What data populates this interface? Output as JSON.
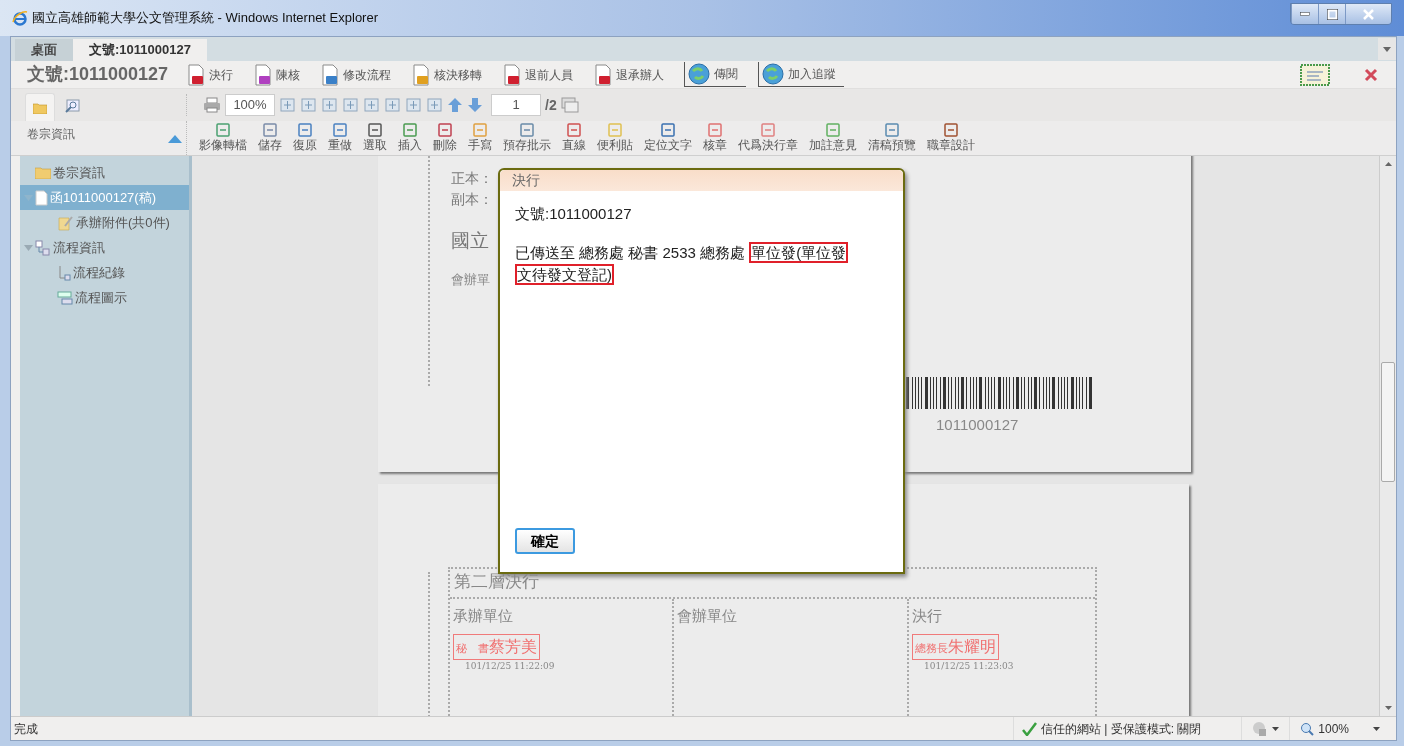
{
  "window": {
    "title": "國立高雄師範大學公文管理系統 - Windows Internet Explorer"
  },
  "tabs": [
    {
      "label": "桌面",
      "selected": false
    },
    {
      "label": "文號:1011000127",
      "selected": true
    }
  ],
  "action_bar": {
    "title": "文號:1011000127",
    "buttons": [
      {
        "label": "決行",
        "kind": "plain"
      },
      {
        "label": "陳核",
        "kind": "plain"
      },
      {
        "label": "修改流程",
        "kind": "plain"
      },
      {
        "label": "核決移轉",
        "kind": "plain"
      },
      {
        "label": "退前人員",
        "kind": "plain"
      },
      {
        "label": "退承辦人",
        "kind": "plain"
      },
      {
        "label": "傳閱",
        "kind": "globe"
      },
      {
        "label": "加入追蹤",
        "kind": "globe"
      }
    ]
  },
  "view_toolbar": {
    "zoom": "100%",
    "page": "1",
    "page_total": "/2"
  },
  "tool_panel": {
    "title": "卷宗資訊",
    "tools": [
      "影像轉檔",
      "儲存",
      "復原",
      "重做",
      "選取",
      "插入",
      "刪除",
      "手寫",
      "預存批示",
      "直線",
      "便利貼",
      "定位文字",
      "核章",
      "代爲決行章",
      "加註意見",
      "清稿預覽",
      "職章設計"
    ]
  },
  "sidebar": {
    "items": [
      {
        "label": "卷宗資訊",
        "kind": "folder",
        "selected": false
      },
      {
        "label": "函1011000127(稿)",
        "kind": "document",
        "selected": true,
        "expanded": true,
        "children": [
          {
            "label": "承辦附件(共0件)",
            "kind": "attachment",
            "selected": false
          }
        ]
      },
      {
        "label": "流程資訊",
        "kind": "flow",
        "selected": false,
        "expanded": true,
        "children": [
          {
            "label": "流程紀錄",
            "kind": "record",
            "selected": false
          },
          {
            "label": "流程圖示",
            "kind": "chart",
            "selected": false
          }
        ]
      }
    ]
  },
  "document": {
    "page_1": {
      "lines": [
        "正本：",
        "副本："
      ],
      "heading": "國立",
      "cosign": "會辦單",
      "barcode_number": "1011000127"
    },
    "page_2": {
      "section_title": "第二層決行",
      "columns": [
        {
          "heading": "承辦單位",
          "stamp": {
            "title": "秘　書",
            "name": "蔡芳美",
            "time": "101/12/25 11:22:09"
          }
        },
        {
          "heading": "會辦單位"
        },
        {
          "heading": "決行",
          "stamp": {
            "title": "總務長",
            "name": "朱耀明",
            "time": "101/12/25 11:23:03"
          }
        }
      ]
    }
  },
  "dialog": {
    "title": "決行",
    "doc_number": "文號:1011000127",
    "message": "已傳送至 總務處 秘書 2533 總務處 ",
    "highlight": "單位發(單位發文待發文登記)",
    "button": "確定"
  },
  "status_bar": {
    "text": "完成",
    "zone": "信任的網站 | 受保護模式: 關閉",
    "zoom": "100%"
  }
}
